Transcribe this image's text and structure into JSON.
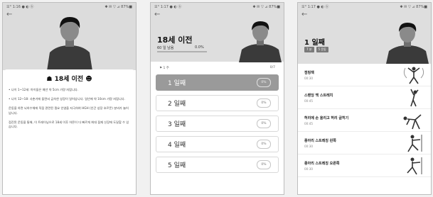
{
  "panel1": {
    "status_left": "오° 1:16 ● ◐ ⓑ",
    "status_right": "✱ ✉ ▽ ⊿ 87%■",
    "heading": "18세 이전",
    "paragraphs": [
      "• 나이 1~12세: 아이들은 매년 약 5cm 가량 자랍니다.",
      "• 나이 12~18: 사춘기에 들면서 급속한 성장이 일어납니다. 일년에 약 10cm 가량 자랍니다.",
      "운동을 하면 뇌하수체에 직접 관련된 필요 인영을 자극하여 HGH (인간 성장 호르몬) 분비가 늘어납니다.",
      "점진된 운동을 통해, 이 트레이닝으로 18세 이후 어른이 더 빠르게 최대 잠재 신장에 도달할 수 있습니다."
    ]
  },
  "panel2": {
    "status_left": "오° 1:17 ● ◐ ⓑ",
    "status_right": "✱ ✉ ▽ ⊿ 87%■",
    "title": "18세 이전",
    "progress_label": "60 일 남음",
    "progress_pct": "0.0%",
    "week_label": "1 주",
    "week_count": "0/7",
    "days": [
      {
        "label": "1 일째",
        "pct": "0%",
        "active": true
      },
      {
        "label": "2 일째",
        "pct": "0%",
        "active": false
      },
      {
        "label": "3 일째",
        "pct": "0%",
        "active": false
      },
      {
        "label": "4 일째",
        "pct": "0%",
        "active": false
      },
      {
        "label": "5 일째",
        "pct": "0%",
        "active": false
      }
    ]
  },
  "panel3": {
    "status_left": "오° 1:17 ● ◐ ⓑ",
    "status_right": "✱ ✉ ▽ ⊿ 87%■",
    "title": "1 일째",
    "tags": [
      "7 분",
      "5 운동"
    ],
    "exercises": [
      {
        "name": "점핑잭",
        "duration": "00:30",
        "figure": "jumping-jack-icon"
      },
      {
        "name": "스탠딩 백 스트레치",
        "duration": "00:45",
        "figure": "back-stretch-icon"
      },
      {
        "name": "허리에 손 올리고 허리 굽히기",
        "duration": "00:45",
        "figure": "waist-bend-icon"
      },
      {
        "name": "종아리 스트레칭 왼쪽",
        "duration": "00:30",
        "figure": "calf-stretch-left-icon"
      },
      {
        "name": "종아리 스트레칭 오른쪽",
        "duration": "00:30",
        "figure": "calf-stretch-right-icon"
      }
    ]
  },
  "colors": {
    "accent": "#9a9a9a",
    "header_bg": "#dcdcdc"
  }
}
